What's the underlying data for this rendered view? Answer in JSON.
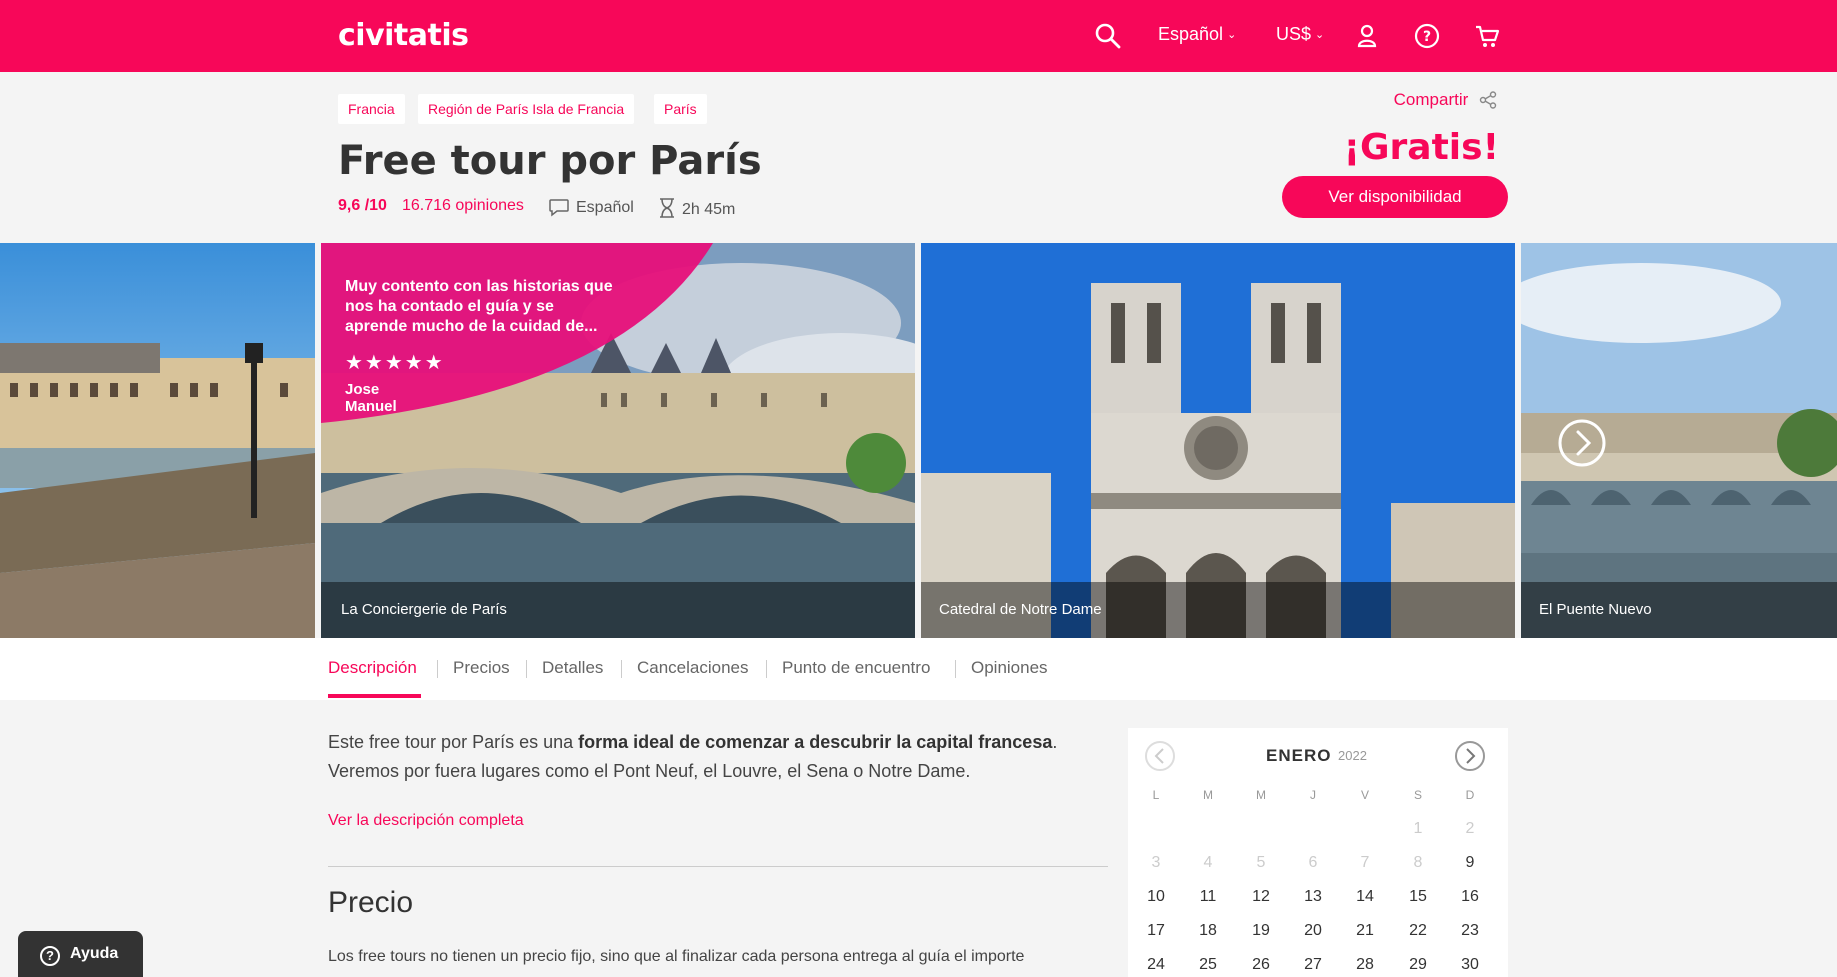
{
  "header": {
    "logo": "civitatis",
    "language": "Español",
    "currency": "US$"
  },
  "breadcrumbs": [
    "Francia",
    "Región de París Isla de Francia",
    "París"
  ],
  "share_label": "Compartir",
  "title": "Free tour por París",
  "rating": "9,6 /10",
  "reviews": "16.716 opiniones",
  "tour_language": "Español",
  "duration": "2h 45m",
  "price_label": "¡Gratis!",
  "availability_button": "Ver disponibilidad",
  "gallery": {
    "review": {
      "text": "Muy contento con las historias que nos ha contado el guía y se aprende mucho de la cuidad de...",
      "stars": "★★★★★",
      "author": "Jose Manuel"
    },
    "captions": [
      "La Conciergerie de París",
      "Catedral de Notre Dame",
      "El Puente Nuevo"
    ]
  },
  "tabs": [
    "Descripción",
    "Precios",
    "Detalles",
    "Cancelaciones",
    "Punto de encuentro",
    "Opiniones"
  ],
  "description": {
    "part1": "Este free tour por París es una ",
    "bold": "forma ideal de comenzar a descubrir la capital francesa",
    "part2": ". Veremos por fuera lugares como el Pont Neuf, el Louvre, el Sena o Notre Dame.",
    "more_link": "Ver la descripción completa"
  },
  "price_section": {
    "title": "Precio",
    "text": "Los free tours no tienen un precio fijo, sino que al finalizar cada persona entrega al guía el importe"
  },
  "calendar": {
    "month": "ENERO",
    "year": "2022",
    "weekdays": [
      "L",
      "M",
      "M",
      "J",
      "V",
      "S",
      "D"
    ],
    "rows": [
      [
        "",
        "",
        "",
        "",
        "",
        "1",
        "2"
      ],
      [
        "3",
        "4",
        "5",
        "6",
        "7",
        "8",
        "9"
      ],
      [
        "10",
        "11",
        "12",
        "13",
        "14",
        "15",
        "16"
      ],
      [
        "17",
        "18",
        "19",
        "20",
        "21",
        "22",
        "23"
      ],
      [
        "24",
        "25",
        "26",
        "27",
        "28",
        "29",
        "30"
      ]
    ],
    "disabled_days": [
      "1",
      "2",
      "3",
      "4",
      "5",
      "6",
      "7",
      "8"
    ]
  },
  "help_button": "Ayuda",
  "colors": {
    "brand": "#f70759",
    "background": "#f4f4f4"
  }
}
